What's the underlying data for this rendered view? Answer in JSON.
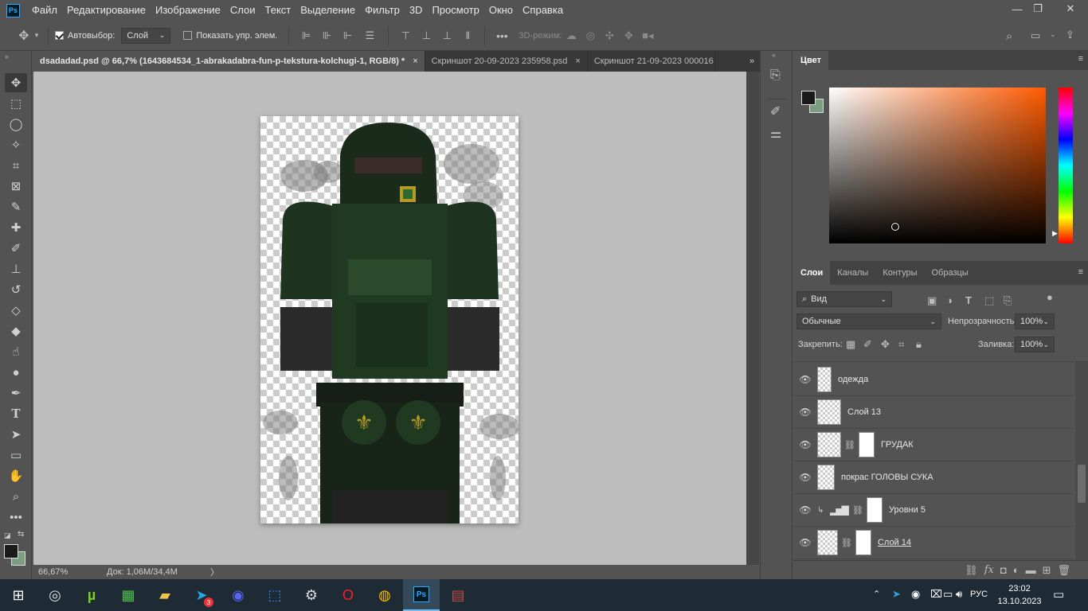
{
  "menu": [
    "Файл",
    "Редактирование",
    "Изображение",
    "Слои",
    "Текст",
    "Выделение",
    "Фильтр",
    "3D",
    "Просмотр",
    "Окно",
    "Справка"
  ],
  "app_logo": "Ps",
  "options": {
    "autoselect_label": "Автовыбор:",
    "autoselect_value": "Слой",
    "show_transform_label": "Показать упр. элем.",
    "mode3d_label": "3D-режим:"
  },
  "tabs": [
    {
      "label": "dsadadad.psd @ 66,7% (1643684534_1-abrakadabra-fun-p-tekstura-kolchugi-1, RGB/8) *",
      "close": "×"
    },
    {
      "label": "Скриншот 20-09-2023 235958.psd",
      "close": "×"
    },
    {
      "label": "Скриншот 21-09-2023 000016",
      "close": ""
    }
  ],
  "tab_overflow": "»",
  "status": {
    "zoom": "66,67%",
    "doc": "Док: 1,06M/34,4M",
    "arrow": "〉"
  },
  "color_panel": {
    "title": "Цвет",
    "fg": "#1a1a1a",
    "bg": "#7a9e7e"
  },
  "layers_panel": {
    "tabs": [
      "Слои",
      "Каналы",
      "Контуры",
      "Образцы"
    ],
    "filter_value": "Вид",
    "blend_mode": "Обычные",
    "opacity_label": "Непрозрачность:",
    "opacity_value": "100%",
    "lock_label": "Закрепить:",
    "fill_label": "Заливка:",
    "fill_value": "100%",
    "layers": [
      {
        "name": "одежда",
        "mask": false
      },
      {
        "name": "Слой 13",
        "mask": false
      },
      {
        "name": "ГРУДАК",
        "mask": true
      },
      {
        "name": "покрас ГОЛОВЫ СУКА",
        "mask": false
      },
      {
        "name": "Уровни 5",
        "mask": true,
        "adjustment": true
      },
      {
        "name": "Слой 14",
        "mask": true
      }
    ]
  },
  "taskbar": {
    "lang": "РУС",
    "time": "23:02",
    "date": "13.10.2023",
    "telegram_badge": "3"
  },
  "colors": {
    "accent": "#31a8ff",
    "ui_bg": "#535353",
    "canvas_bg": "#bdbdbd",
    "armor_green": "#1f3a20"
  }
}
